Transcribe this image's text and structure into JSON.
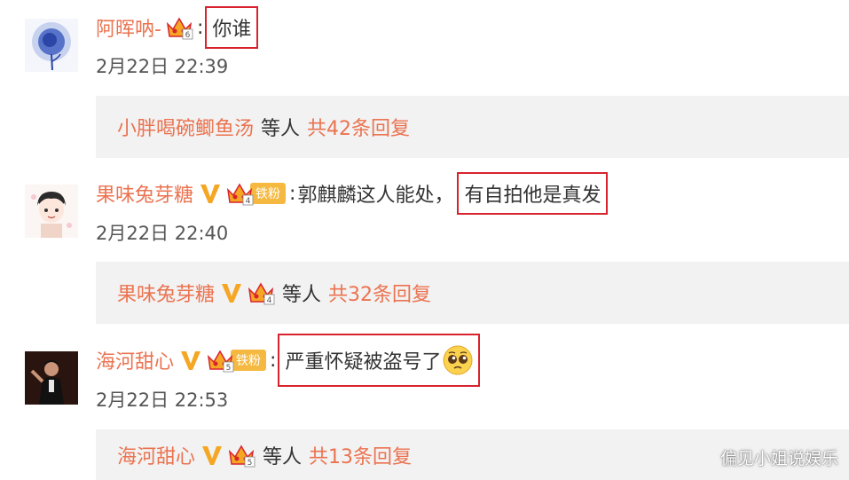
{
  "comments": [
    {
      "username": "阿晖呐-",
      "colon": ":",
      "text": "",
      "highlight": "你谁",
      "date": "2月22日 22:39",
      "verified": false,
      "fan_badge": "",
      "avatar_icon": "blue-rose-avatar",
      "reply": {
        "username": "小胖喝碗鲫鱼汤",
        "etc": "等人",
        "count": "共42条回复"
      }
    },
    {
      "username": "果味兔芽糖",
      "colon": ":",
      "text": "郭麒麟这人能处，",
      "highlight": "有自拍他是真发",
      "date": "2月22日 22:40",
      "verified": true,
      "fan_badge": "铁粉",
      "avatar_icon": "cartoon-boy-avatar",
      "reply": {
        "username": "果味兔芽糖",
        "etc": "等人",
        "count": "共32条回复"
      }
    },
    {
      "username": "海河甜心",
      "colon": ":",
      "text": "",
      "highlight": "严重怀疑被盗号了",
      "date": "2月22日 22:53",
      "verified": true,
      "fan_badge": "铁粉",
      "avatar_icon": "performer-photo-avatar",
      "reply": {
        "username": "海河甜心",
        "etc": "等人",
        "count": "共13条回复"
      }
    }
  ],
  "watermark": "偏见小姐说娱乐",
  "colors": {
    "username": "#eb7350",
    "highlight_border": "#d8232e",
    "reply_bg": "#f2f2f2",
    "verified_v": "#f5a623",
    "fan_badge_bg": "#f5b941"
  }
}
